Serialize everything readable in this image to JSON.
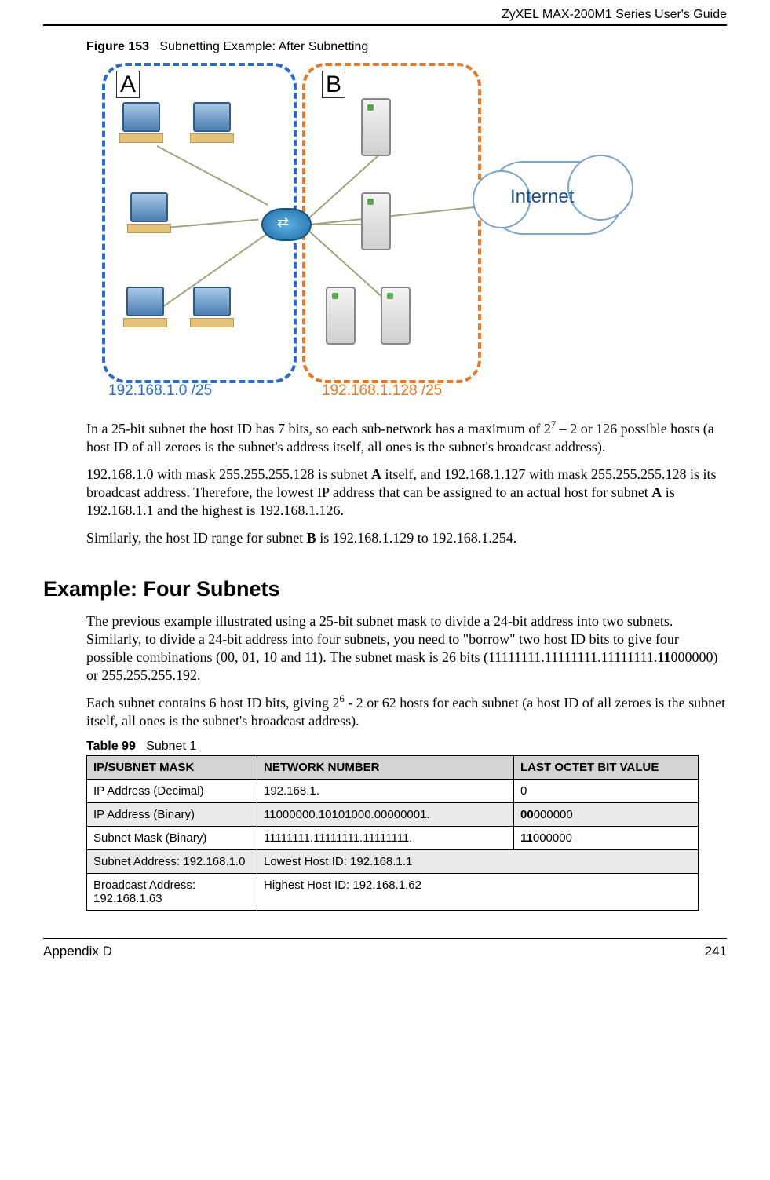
{
  "header": {
    "guide": "ZyXEL MAX-200M1 Series User's Guide"
  },
  "figure": {
    "label": "Figure 153",
    "caption": "Subnetting Example: After Subnetting",
    "zoneA": "A",
    "zoneB": "B",
    "ipA": "192.168.1.0 /25",
    "ipB": "192.168.1.128 /25",
    "cloud": "Internet"
  },
  "para1_a": "In a 25-bit subnet the host ID has 7 bits, so each sub-network has a maximum of 2",
  "para1_exp": "7",
  "para1_b": " – 2 or 126 possible hosts (a host ID of all zeroes is the subnet's address itself, all ones is the subnet's broadcast address).",
  "para2_a": "192.168.1.0 with mask 255.255.255.128 is subnet ",
  "para2_bold1": "A",
  "para2_b": " itself, and 192.168.1.127 with mask 255.255.255.128 is its broadcast address. Therefore, the lowest IP address that can be assigned to an actual host for subnet ",
  "para2_bold2": "A",
  "para2_c": " is 192.168.1.1 and the highest is 192.168.1.126.",
  "para3_a": "Similarly, the host ID range for subnet ",
  "para3_bold": "B",
  "para3_b": " is 192.168.1.129 to 192.168.1.254.",
  "section": "Example: Four Subnets",
  "para4_a": "The previous example illustrated using a 25-bit subnet mask to divide a 24-bit address into two subnets. Similarly, to divide a 24-bit address into four subnets, you need to \"borrow\" two host ID bits to give four possible combinations (00, 01, 10 and 11). The subnet mask is 26 bits (11111111.11111111.11111111.",
  "para4_bold": "11",
  "para4_b": "000000) or 255.255.255.192.",
  "para5_a": "Each subnet contains 6 host ID bits, giving 2",
  "para5_exp": "6",
  "para5_b": " - 2 or 62 hosts for each subnet (a host ID of all zeroes is the subnet itself, all ones is the subnet's broadcast address).",
  "table": {
    "label": "Table 99",
    "caption": "Subnet 1",
    "h1": "IP/SUBNET MASK",
    "h2": "NETWORK NUMBER",
    "h3": "LAST OCTET BIT VALUE",
    "r1c1": "IP Address (Decimal)",
    "r1c2": "192.168.1.",
    "r1c3": "0",
    "r2c1": "IP Address (Binary)",
    "r2c2": "11000000.10101000.00000001.",
    "r2c3_bold": "00",
    "r2c3_rest": "000000",
    "r3c1": "Subnet Mask (Binary)",
    "r3c2": "11111111.11111111.11111111.",
    "r3c3_bold": "11",
    "r3c3_rest": "000000",
    "r4c1": "Subnet Address: 192.168.1.0",
    "r4c2": "Lowest Host ID: 192.168.1.1",
    "r5c1": "Broadcast Address: 192.168.1.63",
    "r5c2": "Highest Host ID: 192.168.1.62"
  },
  "footer": {
    "left": "Appendix D",
    "right": "241"
  }
}
